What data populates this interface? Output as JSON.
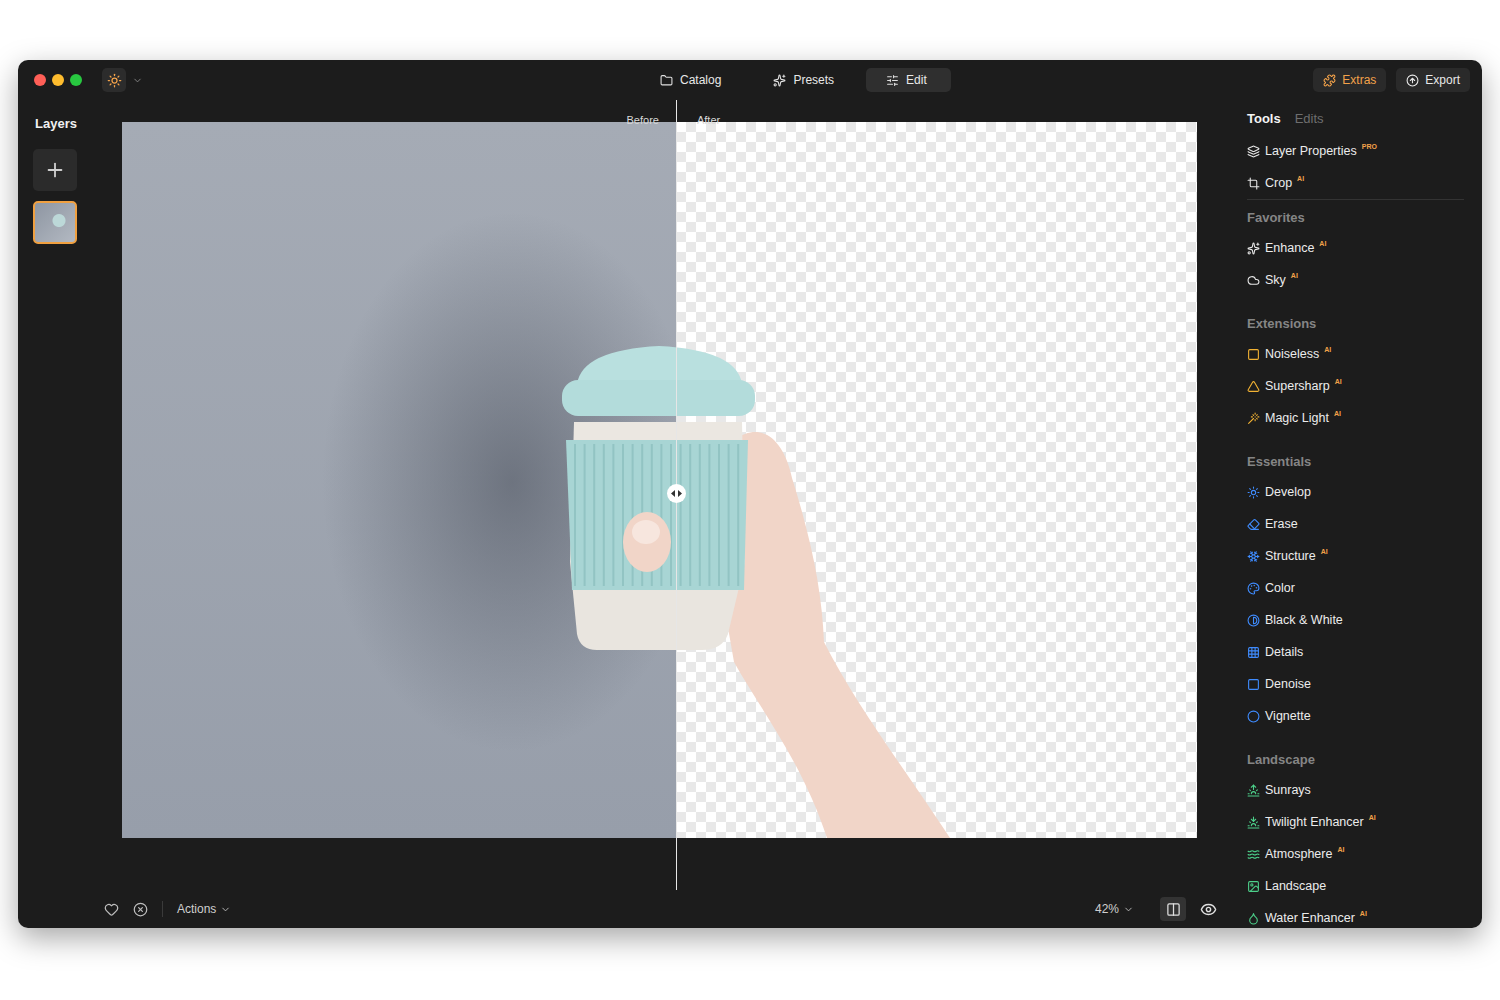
{
  "nav_tabs": [
    {
      "label": "Catalog",
      "selected": false
    },
    {
      "label": "Presets",
      "selected": false
    },
    {
      "label": "Edit",
      "selected": true
    }
  ],
  "header_buttons": [
    {
      "label": "Extras",
      "accent": true
    },
    {
      "label": "Export",
      "accent": false
    }
  ],
  "layers": {
    "title": "Layers",
    "items": [
      {
        "selected": true
      }
    ]
  },
  "canvas": {
    "before_label": "Before",
    "after_label": "After",
    "level": 0.5153
  },
  "bottom_bar": {
    "actions": "Actions",
    "zoom": "42%",
    "compare_on": true
  },
  "panel": {
    "tabs": [
      {
        "label": "Tools",
        "selected": true
      },
      {
        "label": "Edits",
        "selected": false
      }
    ],
    "sections": [
      {
        "title": "",
        "color": "#e6e6e6",
        "items": [
          {
            "label": "Layer Properties",
            "badge": "PRO"
          },
          {
            "label": "Crop",
            "badge": "AI"
          }
        ]
      },
      {
        "title": "Favorites",
        "color": "#e6e6e6",
        "items": [
          {
            "label": "Enhance",
            "badge": "AI"
          },
          {
            "label": "Sky",
            "badge": "AI"
          }
        ]
      },
      {
        "title": "Extensions",
        "color": "#f2b233",
        "items": [
          {
            "label": "Noiseless",
            "badge": "AI"
          },
          {
            "label": "Supersharp",
            "badge": "AI"
          },
          {
            "label": "Magic Light",
            "badge": "AI"
          }
        ]
      },
      {
        "title": "Essentials",
        "color": "#3f8cff",
        "items": [
          {
            "label": "Develop",
            "badge": ""
          },
          {
            "label": "Erase",
            "badge": ""
          },
          {
            "label": "Structure",
            "badge": "AI"
          },
          {
            "label": "Color",
            "badge": ""
          },
          {
            "label": "Black & White",
            "badge": ""
          },
          {
            "label": "Details",
            "badge": ""
          },
          {
            "label": "Denoise",
            "badge": ""
          },
          {
            "label": "Vignette",
            "badge": ""
          }
        ]
      },
      {
        "title": "Landscape",
        "color": "#4cd08a",
        "items": [
          {
            "label": "Sunrays",
            "badge": ""
          },
          {
            "label": "Twilight Enhancer",
            "badge": "AI"
          },
          {
            "label": "Atmosphere",
            "badge": "AI"
          },
          {
            "label": "Landscape",
            "badge": ""
          },
          {
            "label": "Water Enhancer",
            "badge": "AI"
          }
        ]
      }
    ]
  }
}
